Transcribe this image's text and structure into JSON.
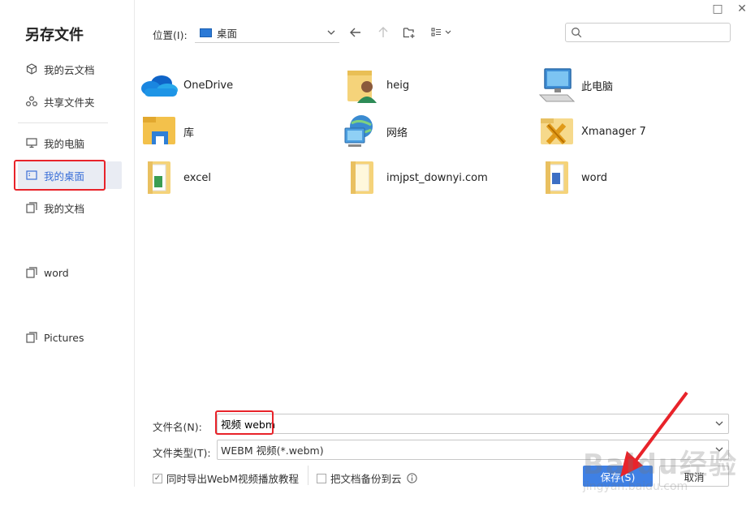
{
  "dialog": {
    "title": "另存文件"
  },
  "window": {
    "maximize_glyph": "□",
    "close_glyph": "✕"
  },
  "sidebar": {
    "items": [
      {
        "label": "我的云文档",
        "icon": "cloud-doc-icon"
      },
      {
        "label": "共享文件夹",
        "icon": "shared-folder-icon"
      },
      {
        "label": "我的电脑",
        "icon": "computer-icon"
      },
      {
        "label": "我的桌面",
        "icon": "desktop-icon"
      },
      {
        "label": "我的文档",
        "icon": "documents-icon"
      },
      {
        "label": "word",
        "icon": "folder-icon"
      },
      {
        "label": "Pictures",
        "icon": "folder-icon"
      }
    ]
  },
  "toolbar": {
    "location_label": "位置(I):",
    "location_value": "桌面"
  },
  "files": [
    {
      "name": "OneDrive",
      "icon": "onedrive-icon"
    },
    {
      "name": "heig",
      "icon": "user-folder-icon"
    },
    {
      "name": "此电脑",
      "icon": "this-pc-icon"
    },
    {
      "name": "库",
      "icon": "library-icon"
    },
    {
      "name": "网络",
      "icon": "network-icon"
    },
    {
      "name": "Xmanager 7",
      "icon": "xmanager-icon"
    },
    {
      "name": "excel",
      "icon": "folder-icon"
    },
    {
      "name": "imjpst_downyi.com",
      "icon": "folder-icon"
    },
    {
      "name": "word",
      "icon": "folder-icon"
    }
  ],
  "form": {
    "filename_label": "文件名(N):",
    "filename_value": "视频 webm",
    "filetype_label": "文件类型(T):",
    "filetype_value": "WEBM 视频(*.webm)",
    "export_tutorial_label": "同时导出WebM视频播放教程",
    "backup_cloud_label": "把文档备份到云",
    "save_label": "保存(S)",
    "cancel_label": "取消"
  },
  "watermark": {
    "main": "Baidu经验",
    "sub": "jingyan.baidu.com"
  },
  "colors": {
    "accent": "#3f80e4",
    "annotation": "#e8232a"
  }
}
